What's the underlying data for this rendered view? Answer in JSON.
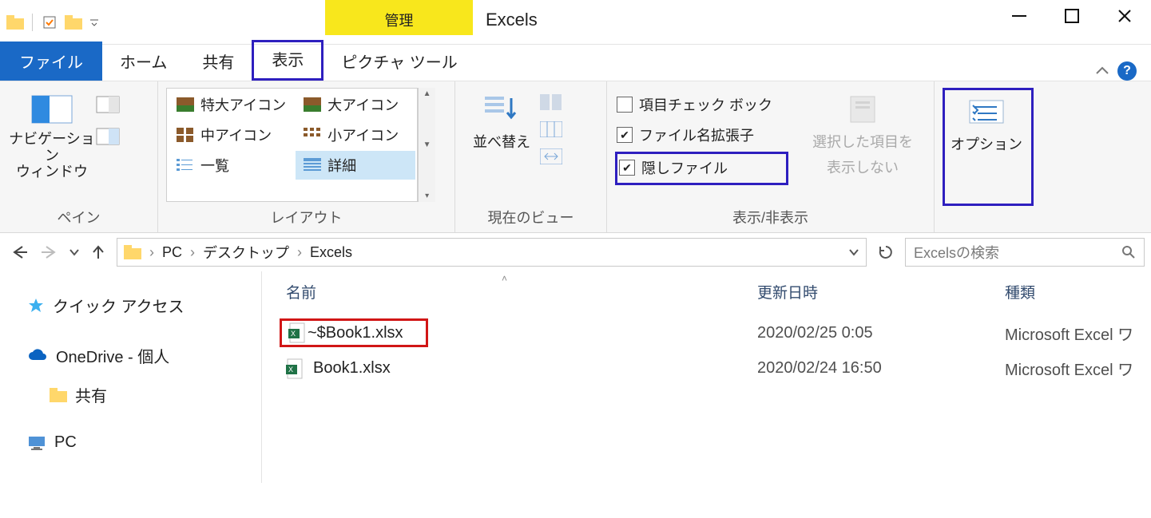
{
  "titlebar": {
    "context_tab": "管理",
    "window_title": "Excels"
  },
  "tabs": {
    "file": "ファイル",
    "home": "ホーム",
    "share": "共有",
    "view": "表示",
    "context_tools": "ピクチャ ツール"
  },
  "ribbon": {
    "pane_group": "ペイン",
    "nav_pane": "ナビゲーション\nウィンドウ",
    "layout_group": "レイアウト",
    "layout": {
      "xl_icons": "特大アイコン",
      "l_icons": "大アイコン",
      "m_icons": "中アイコン",
      "s_icons": "小アイコン",
      "list": "一覧",
      "details": "詳細"
    },
    "current_view_group": "現在のビュー",
    "sort": "並べ替え",
    "show_hide_group": "表示/非表示",
    "chk_itemcheck": "項目チェック ボック",
    "chk_ext": "ファイル名拡張子",
    "chk_hidden": "隠しファイル",
    "hide_selected_l1": "選択した項目を",
    "hide_selected_l2": "表示しない",
    "options": "オプション"
  },
  "address": {
    "seg1": "PC",
    "seg2": "デスクトップ",
    "seg3": "Excels"
  },
  "search": {
    "placeholder": "Excelsの検索"
  },
  "tree": {
    "quick": "クイック アクセス",
    "onedrive": "OneDrive - 個人",
    "shared": "共有",
    "pc": "PC"
  },
  "columns": {
    "name": "名前",
    "date": "更新日時",
    "type": "種類"
  },
  "files": [
    {
      "name": "~$Book1.xlsx",
      "date": "2020/02/25 0:05",
      "type": "Microsoft Excel ワ",
      "highlight": true
    },
    {
      "name": "Book1.xlsx",
      "date": "2020/02/24 16:50",
      "type": "Microsoft Excel ワ",
      "highlight": false
    }
  ]
}
